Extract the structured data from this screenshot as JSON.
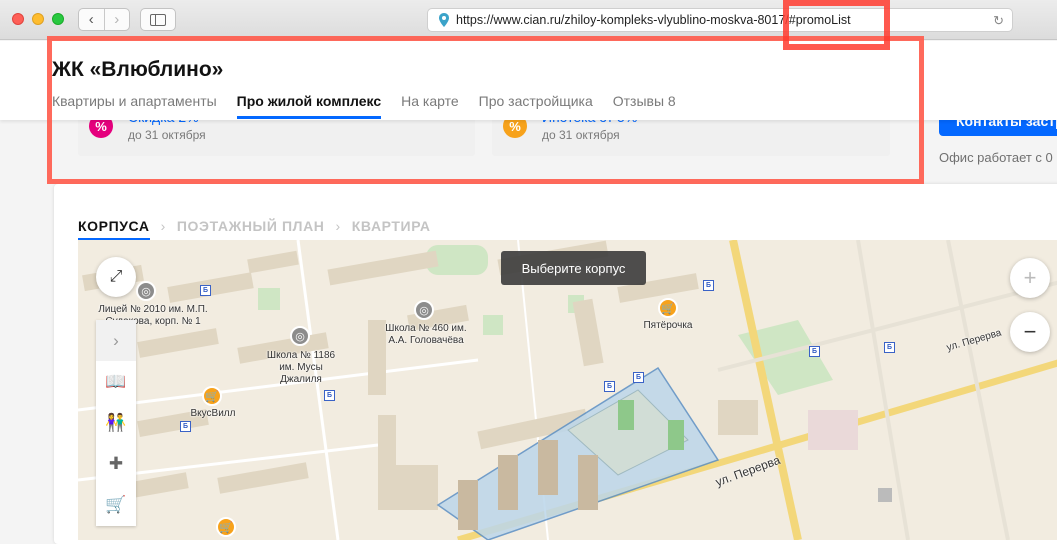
{
  "browser": {
    "url": "https://www.cian.ru/zhiloy-kompleks-vlyublino-moskva-8017/#promoList",
    "back_icon": "chevron-left-icon",
    "forward_icon": "chevron-right-icon"
  },
  "header": {
    "title": "ЖК «Влюблино»",
    "tabs": [
      {
        "label": "Квартиры и апартаменты"
      },
      {
        "label": "Про жилой комплекс"
      },
      {
        "label": "На карте"
      },
      {
        "label": "Про застройщика"
      },
      {
        "label": "Отзывы 8"
      }
    ],
    "active_tab": "Про жилой комплекс",
    "accent_color": "#0468ff"
  },
  "promos": [
    {
      "title": "Скидка 2%",
      "subtitle": "до 31 октября",
      "icon": "percent-icon",
      "color": "#e5007d"
    },
    {
      "title": "Ипотека от 5%",
      "subtitle": "до 31 октября",
      "icon": "mortgage-icon",
      "color": "#f7a21b"
    }
  ],
  "contact": {
    "button_label": "Контакты застр",
    "office_text": "Офис работает с 0"
  },
  "steps": [
    {
      "label": "КОРПУСА"
    },
    {
      "label": "ПОЭТАЖНЫЙ ПЛАН"
    },
    {
      "label": "КВАРТИРА"
    }
  ],
  "map": {
    "tooltip": "Выберите корпус",
    "labels": {
      "school_2010": "Лицей № 2010 им. М.П. Судакова, корп. № 1",
      "school_1186": "Школа № 1186 им. Мусы Джалиля",
      "school_460": "Школа № 460 им. А.А. Головачёва",
      "pyaterochka": "Пятёрочка",
      "vkusvill": "ВкусВилл",
      "street_perva_1": "ул. Перерва",
      "street_perva_2": "ул. Перерва"
    },
    "zoom_in": "+",
    "zoom_out": "−"
  }
}
